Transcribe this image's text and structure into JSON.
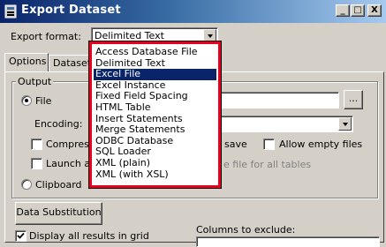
{
  "window": {
    "title": "Export Dataset",
    "minimize_glyph": "_",
    "maximize_glyph": "□",
    "close_glyph": "X"
  },
  "export_format": {
    "label": "Export format:",
    "value": "Delimited Text",
    "options": [
      "Access Database File",
      "Delimited Text",
      "Excel File",
      "Excel Instance",
      "Fixed Field Spacing",
      "HTML Table",
      "Insert Statements",
      "Merge Statements",
      "ODBC Database",
      "SQL Loader",
      "XML (plain)",
      "XML (with XSL)"
    ],
    "highlighted_index": 2
  },
  "tabs": [
    {
      "label": "Options",
      "active": true
    },
    {
      "label": "Dataset",
      "active": false
    }
  ],
  "output": {
    "group_label": "Output",
    "file_label": "File",
    "file_selected": true,
    "browse_label": "...",
    "encoding_label": "Encoding:",
    "compress_label": "Compress",
    "save_label": "save",
    "allow_empty_files_label": "Allow empty files",
    "launch_label": "Launch aft",
    "file_for_all_tables_label": "e file for all tables",
    "clipboard_label": "Clipboard",
    "clipboard_selected": false
  },
  "data_substitution_label": "Data Substitution",
  "columns_to_exclude_label": "Columns to exclude:",
  "display_all_results": {
    "label": "Display all results in grid",
    "checked": true
  },
  "colors": {
    "highlight": "#0a246a",
    "dropdown_border": "#e8001c"
  }
}
